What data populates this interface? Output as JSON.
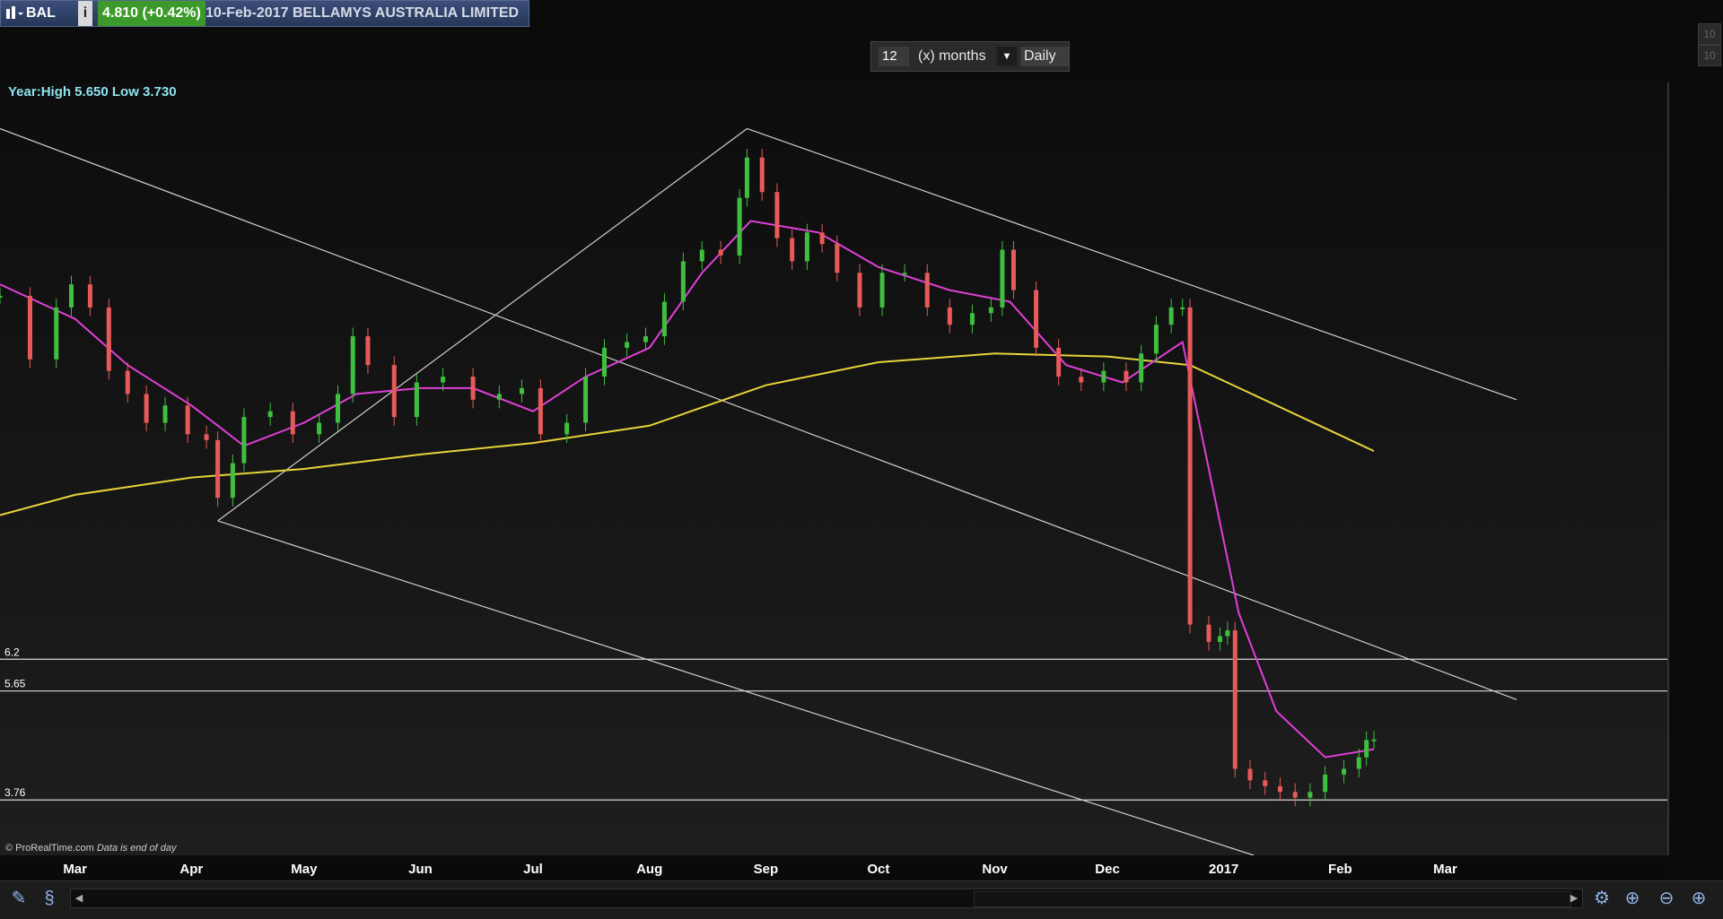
{
  "header": {
    "symbol": "BAL",
    "last_price_change": "4.810 (+0.42%)",
    "title": "10-Feb-2017 BELLAMYS AUSTRALIA LIMITED",
    "right_clipped_values": [
      "10",
      "10"
    ]
  },
  "period": {
    "value": "12",
    "unit_label": "(x) months",
    "frequency": "Daily"
  },
  "year_info": "Year:High 5.650 Low 3.730",
  "credit": {
    "source": "© ProRealTime.com",
    "note": "Data is end of day"
  },
  "icons": {
    "symbol_menu": "chart-window-icon",
    "info": "info-icon",
    "draw": "drawing-tools-icon",
    "indicator": "indicator-icon",
    "zoom_fit": "zoom-fit-icon",
    "zoom_out": "zoom-out-icon",
    "zoom_in": "zoom-in-icon"
  },
  "colors": {
    "up": "#3fbf3f",
    "down": "#e85a5a",
    "ma_short": "#e03fd8",
    "ma_long": "#e8d43a",
    "lines": "#cfcfcf",
    "background": "#151515"
  },
  "chart_data": {
    "type": "candlestick",
    "title": "",
    "xlabel": "",
    "ylabel": "",
    "ylim": [
      2.8,
      16.2
    ],
    "y_ticks": [
      3,
      3.5,
      4,
      4.5,
      5,
      5.5,
      6,
      6.5,
      7,
      7.5,
      8,
      8.5,
      9,
      9.5,
      10,
      10.5,
      11,
      11.5,
      12,
      12.5,
      13,
      13.5,
      14,
      14.5,
      15,
      15.5,
      16
    ],
    "x_ticks": [
      {
        "label": "Mar",
        "date": "2016-03-01"
      },
      {
        "label": "Apr",
        "date": "2016-04-01"
      },
      {
        "label": "May",
        "date": "2016-05-01"
      },
      {
        "label": "Jun",
        "date": "2016-06-01"
      },
      {
        "label": "Jul",
        "date": "2016-07-01"
      },
      {
        "label": "Aug",
        "date": "2016-08-01"
      },
      {
        "label": "Sep",
        "date": "2016-09-01"
      },
      {
        "label": "Oct",
        "date": "2016-10-01"
      },
      {
        "label": "Nov",
        "date": "2016-11-01"
      },
      {
        "label": "Dec",
        "date": "2016-12-01"
      },
      {
        "label": "2017",
        "date": "2017-01-01"
      },
      {
        "label": "Feb",
        "date": "2017-02-01"
      },
      {
        "label": "Mar",
        "date": "2017-03-01"
      }
    ],
    "xlim": [
      "2016-02-10",
      "2017-03-20"
    ],
    "price_series": [
      {
        "date": "2016-02-10",
        "close": 12.5
      },
      {
        "date": "2016-02-18",
        "close": 11.4
      },
      {
        "date": "2016-02-25",
        "close": 12.3
      },
      {
        "date": "2016-02-29",
        "close": 12.7
      },
      {
        "date": "2016-03-05",
        "close": 12.3
      },
      {
        "date": "2016-03-10",
        "close": 11.2
      },
      {
        "date": "2016-03-15",
        "close": 10.8
      },
      {
        "date": "2016-03-20",
        "close": 10.3
      },
      {
        "date": "2016-03-25",
        "close": 10.6
      },
      {
        "date": "2016-03-31",
        "close": 10.1
      },
      {
        "date": "2016-04-05",
        "close": 10.0
      },
      {
        "date": "2016-04-08",
        "close": 9.0
      },
      {
        "date": "2016-04-12",
        "close": 9.6
      },
      {
        "date": "2016-04-15",
        "close": 10.4
      },
      {
        "date": "2016-04-22",
        "close": 10.5
      },
      {
        "date": "2016-04-28",
        "close": 10.1
      },
      {
        "date": "2016-05-05",
        "close": 10.3
      },
      {
        "date": "2016-05-10",
        "close": 10.8
      },
      {
        "date": "2016-05-14",
        "close": 11.8
      },
      {
        "date": "2016-05-18",
        "close": 11.3
      },
      {
        "date": "2016-05-25",
        "close": 10.4
      },
      {
        "date": "2016-05-31",
        "close": 11.0
      },
      {
        "date": "2016-06-07",
        "close": 11.1
      },
      {
        "date": "2016-06-15",
        "close": 10.7
      },
      {
        "date": "2016-06-22",
        "close": 10.8
      },
      {
        "date": "2016-06-28",
        "close": 10.9
      },
      {
        "date": "2016-07-03",
        "close": 10.1
      },
      {
        "date": "2016-07-10",
        "close": 10.3
      },
      {
        "date": "2016-07-15",
        "close": 11.1
      },
      {
        "date": "2016-07-20",
        "close": 11.6
      },
      {
        "date": "2016-07-26",
        "close": 11.7
      },
      {
        "date": "2016-07-31",
        "close": 11.8
      },
      {
        "date": "2016-08-05",
        "close": 12.4
      },
      {
        "date": "2016-08-10",
        "close": 13.1
      },
      {
        "date": "2016-08-15",
        "close": 13.3
      },
      {
        "date": "2016-08-20",
        "close": 13.2
      },
      {
        "date": "2016-08-25",
        "close": 14.2
      },
      {
        "date": "2016-08-27",
        "close": 14.9
      },
      {
        "date": "2016-08-31",
        "close": 14.3
      },
      {
        "date": "2016-09-04",
        "close": 13.5
      },
      {
        "date": "2016-09-08",
        "close": 13.1
      },
      {
        "date": "2016-09-12",
        "close": 13.6
      },
      {
        "date": "2016-09-16",
        "close": 13.4
      },
      {
        "date": "2016-09-20",
        "close": 12.9
      },
      {
        "date": "2016-09-26",
        "close": 12.3
      },
      {
        "date": "2016-10-02",
        "close": 12.9
      },
      {
        "date": "2016-10-08",
        "close": 12.9
      },
      {
        "date": "2016-10-14",
        "close": 12.3
      },
      {
        "date": "2016-10-20",
        "close": 12.0
      },
      {
        "date": "2016-10-26",
        "close": 12.2
      },
      {
        "date": "2016-10-31",
        "close": 12.3
      },
      {
        "date": "2016-11-03",
        "close": 13.3
      },
      {
        "date": "2016-11-06",
        "close": 12.6
      },
      {
        "date": "2016-11-12",
        "close": 11.6
      },
      {
        "date": "2016-11-18",
        "close": 11.1
      },
      {
        "date": "2016-11-24",
        "close": 11.0
      },
      {
        "date": "2016-11-30",
        "close": 11.2
      },
      {
        "date": "2016-12-06",
        "close": 11.0
      },
      {
        "date": "2016-12-10",
        "close": 11.5
      },
      {
        "date": "2016-12-14",
        "close": 12.0
      },
      {
        "date": "2016-12-18",
        "close": 12.3
      },
      {
        "date": "2016-12-21",
        "close": 12.3
      },
      {
        "date": "2016-12-23",
        "close": 6.8
      },
      {
        "date": "2016-12-28",
        "close": 6.5
      },
      {
        "date": "2016-12-31",
        "close": 6.6
      },
      {
        "date": "2017-01-02",
        "close": 6.7
      },
      {
        "date": "2017-01-04",
        "close": 4.3
      },
      {
        "date": "2017-01-08",
        "close": 4.1
      },
      {
        "date": "2017-01-12",
        "close": 4.0
      },
      {
        "date": "2017-01-16",
        "close": 3.9
      },
      {
        "date": "2017-01-20",
        "close": 3.8
      },
      {
        "date": "2017-01-24",
        "close": 3.9
      },
      {
        "date": "2017-01-28",
        "close": 4.2
      },
      {
        "date": "2017-02-02",
        "close": 4.3
      },
      {
        "date": "2017-02-06",
        "close": 4.5
      },
      {
        "date": "2017-02-08",
        "close": 4.8
      },
      {
        "date": "2017-02-10",
        "close": 4.81
      }
    ],
    "ma_short": {
      "color": "#e03fd8",
      "last_value": "4.6406",
      "points": [
        {
          "date": "2016-02-10",
          "value": 12.7
        },
        {
          "date": "2016-03-01",
          "value": 12.1
        },
        {
          "date": "2016-03-15",
          "value": 11.3
        },
        {
          "date": "2016-04-01",
          "value": 10.6
        },
        {
          "date": "2016-04-15",
          "value": 9.9
        },
        {
          "date": "2016-05-01",
          "value": 10.3
        },
        {
          "date": "2016-05-15",
          "value": 10.8
        },
        {
          "date": "2016-06-01",
          "value": 10.9
        },
        {
          "date": "2016-06-15",
          "value": 10.9
        },
        {
          "date": "2016-07-01",
          "value": 10.5
        },
        {
          "date": "2016-07-15",
          "value": 11.1
        },
        {
          "date": "2016-08-01",
          "value": 11.6
        },
        {
          "date": "2016-08-15",
          "value": 12.9
        },
        {
          "date": "2016-08-28",
          "value": 13.8
        },
        {
          "date": "2016-09-15",
          "value": 13.6
        },
        {
          "date": "2016-10-01",
          "value": 13.0
        },
        {
          "date": "2016-10-20",
          "value": 12.6
        },
        {
          "date": "2016-11-05",
          "value": 12.4
        },
        {
          "date": "2016-11-20",
          "value": 11.3
        },
        {
          "date": "2016-12-05",
          "value": 11.0
        },
        {
          "date": "2016-12-21",
          "value": 11.7
        },
        {
          "date": "2016-12-28",
          "value": 9.5
        },
        {
          "date": "2017-01-05",
          "value": 7.0
        },
        {
          "date": "2017-01-15",
          "value": 5.3
        },
        {
          "date": "2017-01-28",
          "value": 4.5
        },
        {
          "date": "2017-02-10",
          "value": 4.64
        }
      ]
    },
    "ma_long": {
      "color": "#e8d43a",
      "last_value": "9.8122",
      "points": [
        {
          "date": "2016-02-10",
          "value": 8.7
        },
        {
          "date": "2016-03-01",
          "value": 9.05
        },
        {
          "date": "2016-04-01",
          "value": 9.35
        },
        {
          "date": "2016-05-01",
          "value": 9.5
        },
        {
          "date": "2016-06-01",
          "value": 9.75
        },
        {
          "date": "2016-07-01",
          "value": 9.95
        },
        {
          "date": "2016-08-01",
          "value": 10.25
        },
        {
          "date": "2016-09-01",
          "value": 10.95
        },
        {
          "date": "2016-10-01",
          "value": 11.35
        },
        {
          "date": "2016-11-01",
          "value": 11.5
        },
        {
          "date": "2016-12-01",
          "value": 11.45
        },
        {
          "date": "2016-12-23",
          "value": 11.3
        },
        {
          "date": "2017-01-15",
          "value": 10.6
        },
        {
          "date": "2017-02-10",
          "value": 9.81
        }
      ]
    },
    "horizontal_lines": [
      {
        "label": "6.2",
        "value": 6.2
      },
      {
        "label": "5.65",
        "value": 5.65
      },
      {
        "label": "3.76",
        "value": 3.76
      }
    ],
    "trend_lines": [
      {
        "from": {
          "date": "2016-02-10",
          "value": 15.4
        },
        "to": {
          "date": "2017-03-20",
          "value": 5.5
        }
      },
      {
        "from": {
          "date": "2016-04-08",
          "value": 8.6
        },
        "to": {
          "date": "2017-01-09",
          "value": 2.8
        }
      },
      {
        "from": {
          "date": "2016-04-08",
          "value": 8.6
        },
        "to": {
          "date": "2016-08-27",
          "value": 15.4
        }
      },
      {
        "from": {
          "date": "2016-08-27",
          "value": 15.4
        },
        "to": {
          "date": "2017-03-20",
          "value": 10.7
        }
      }
    ],
    "last_price": {
      "value": 4.81,
      "label": "4.810"
    }
  }
}
